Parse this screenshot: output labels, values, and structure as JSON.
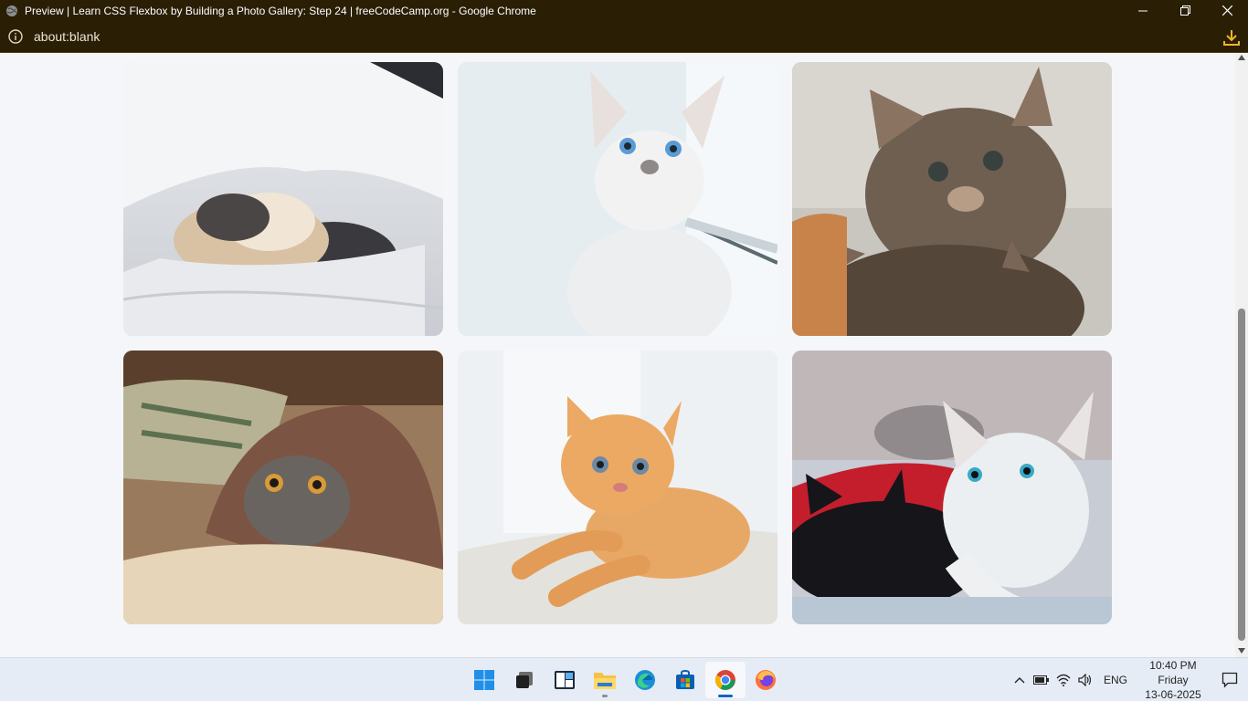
{
  "window": {
    "title": "Preview | Learn CSS Flexbox by Building a Photo Gallery: Step 24 | freeCodeCamp.org - Google Chrome"
  },
  "address": {
    "url": "about:blank"
  },
  "gallery": {
    "photos": [
      {
        "subject": "sleeping-calico-kitten-under-blanket"
      },
      {
        "subject": "white-blue-eyed-kitten-by-window"
      },
      {
        "subject": "tabby-kittens"
      },
      {
        "subject": "tabby-kitten-under-rug"
      },
      {
        "subject": "orange-kitten-lying"
      },
      {
        "subject": "black-and-white-kittens"
      }
    ]
  },
  "taskbar": {
    "apps": [
      "start-icon",
      "task-view-icon",
      "widgets-icon",
      "file-explorer-icon",
      "edge-icon",
      "store-icon",
      "chrome-icon",
      "firefox-icon"
    ],
    "language": "ENG",
    "time": "10:40 PM",
    "day": "Friday",
    "date": "13-06-2025"
  },
  "colors": {
    "titlebar": "#2a1e05",
    "page_background": "#f5f6f9",
    "taskbar": "#e6ecf5",
    "accent": "#0067c0"
  }
}
